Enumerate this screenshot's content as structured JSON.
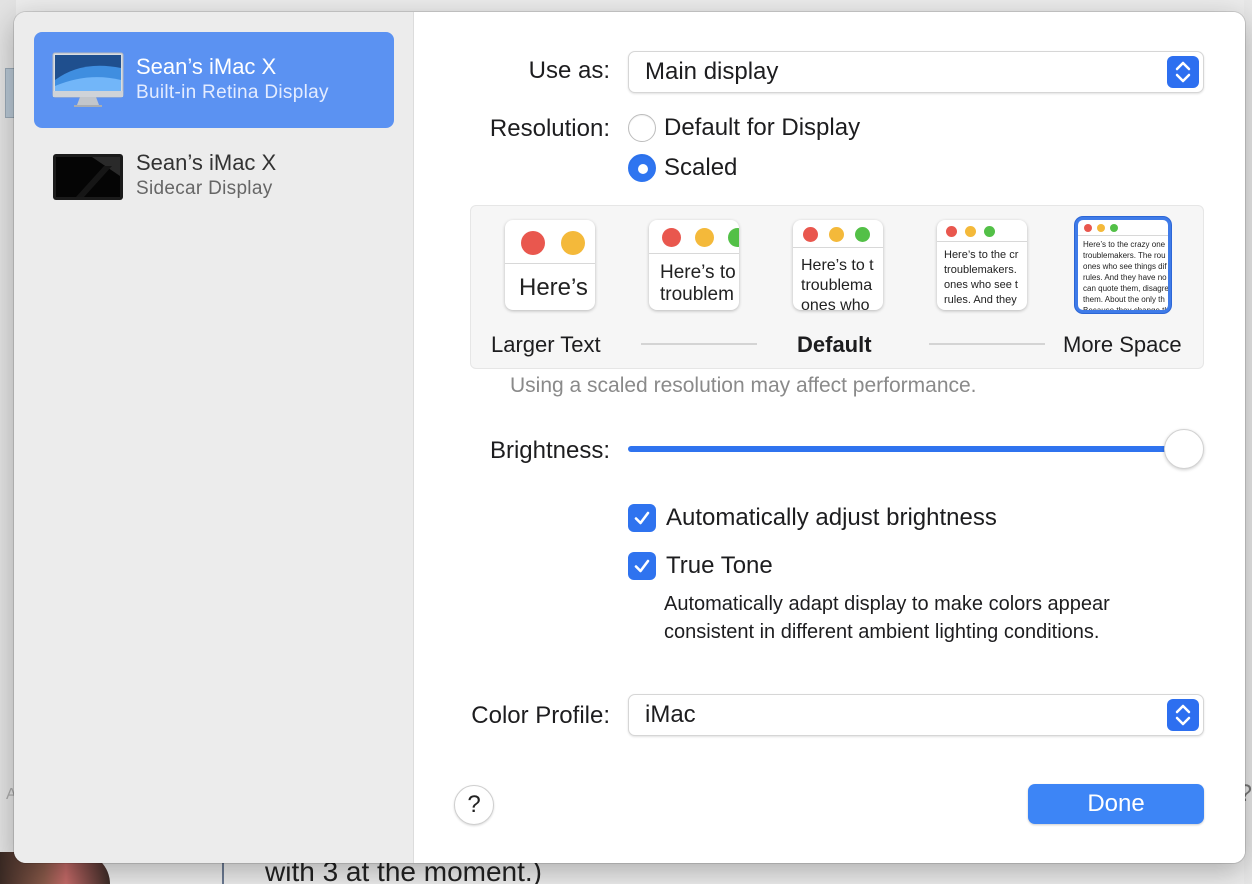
{
  "sidebar": {
    "displays": [
      {
        "name": "Sean’s iMac X",
        "subtitle": "Built-in Retina Display",
        "selected": true,
        "icon": "imac-display-icon"
      },
      {
        "name": "Sean’s iMac X",
        "subtitle": "Sidecar Display",
        "selected": false,
        "icon": "ipad-display-icon"
      }
    ]
  },
  "use_as": {
    "label": "Use as:",
    "value": "Main display"
  },
  "resolution": {
    "label": "Resolution:",
    "options": [
      "Default for Display",
      "Scaled"
    ],
    "selected": "Scaled"
  },
  "scaling": {
    "labels": {
      "left": "Larger Text",
      "middle": "Default",
      "right": "More Space"
    },
    "thumbnails": [
      {
        "text": "Here’s"
      },
      {
        "text": "Here’s to\ntroublem"
      },
      {
        "text": "Here’s to t\ntroublema\nones who"
      },
      {
        "text": "Here’s to the cr\ntroublemakers.\nones who see t\nrules. And they"
      },
      {
        "text": "Here’s to the crazy one\ntroublemakers. The rou\nones who see things dif\nrules. And they have no\ncan quote them, disagre\nthem. About the only th\nBecause they change th"
      }
    ],
    "selected_index": 4,
    "note": "Using a scaled resolution may affect performance."
  },
  "brightness": {
    "label": "Brightness:",
    "level": 1.0
  },
  "auto_brightness": {
    "label": "Automatically adjust brightness",
    "checked": true
  },
  "true_tone": {
    "label": "True Tone",
    "checked": true,
    "description": "Automatically adapt display to make colors appear consistent in different ambient lighting conditions."
  },
  "color_profile": {
    "label": "Color Profile:",
    "value": "iMac"
  },
  "buttons": {
    "help": "?",
    "done": "Done"
  },
  "background": {
    "bottom_text": "with 3 at the moment.)"
  },
  "colors": {
    "accent": "#2f73ef",
    "selection": "#5b92f2",
    "traffic_red": "#e9574e",
    "traffic_yellow": "#f4b93a",
    "traffic_green": "#53c047"
  }
}
